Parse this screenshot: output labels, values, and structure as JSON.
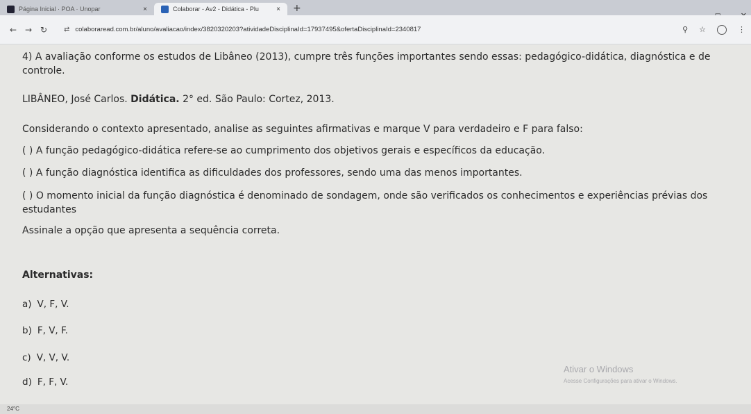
{
  "browser": {
    "tabs": [
      {
        "title": "Página Inicial · POA · Unopar",
        "close": "×"
      },
      {
        "title": "Colaborar - Av2 - Didática - Plu",
        "close": "×"
      }
    ],
    "new_tab": "+",
    "url": "colaboraread.com.br/aluno/avaliacao/index/3820320203?atividadeDisciplinaId=17937495&ofertaDisciplinaId=2340817",
    "window_controls": {
      "minimize": "–",
      "restore": "◻",
      "close": "✕"
    }
  },
  "question": {
    "number_and_stem": "4)  A avaliação conforme os estudos de Libâneo (2013), cumpre três funções importantes sendo essas: pedagógico-didática, diagnóstica e de controle.",
    "reference_prefix": "LIBÂNEO, José Carlos.",
    "reference_title": "Didática.",
    "reference_suffix": "2° ed. São Paulo: Cortez, 2013.",
    "instruction": "Considerando o contexto apresentado, analise as seguintes afirmativas e marque V para verdadeiro e F para falso:",
    "statements": [
      "( ) A função pedagógico-didática refere-se ao cumprimento dos objetivos gerais e específicos da educação.",
      "( ) A função diagnóstica identifica as dificuldades dos professores, sendo uma das menos importantes.",
      "( ) O momento inicial da função diagnóstica é denominado de sondagem, onde são verificados os conhecimentos e experiências prévias dos estudantes"
    ],
    "prompt": "Assinale a opção que apresenta a sequência correta.",
    "alternatives_heading": "Alternativas:",
    "alternatives": [
      {
        "letter": "a)",
        "text": "V, F, V."
      },
      {
        "letter": "b)",
        "text": "F, V, F."
      },
      {
        "letter": "c)",
        "text": "V, V, V."
      },
      {
        "letter": "d)",
        "text": "F, F, V."
      }
    ]
  },
  "watermark": {
    "line1": "Ativar o Windows",
    "line2": "Acesse Configurações para ativar o Windows."
  },
  "taskbar": {
    "temperature": "24°C"
  }
}
